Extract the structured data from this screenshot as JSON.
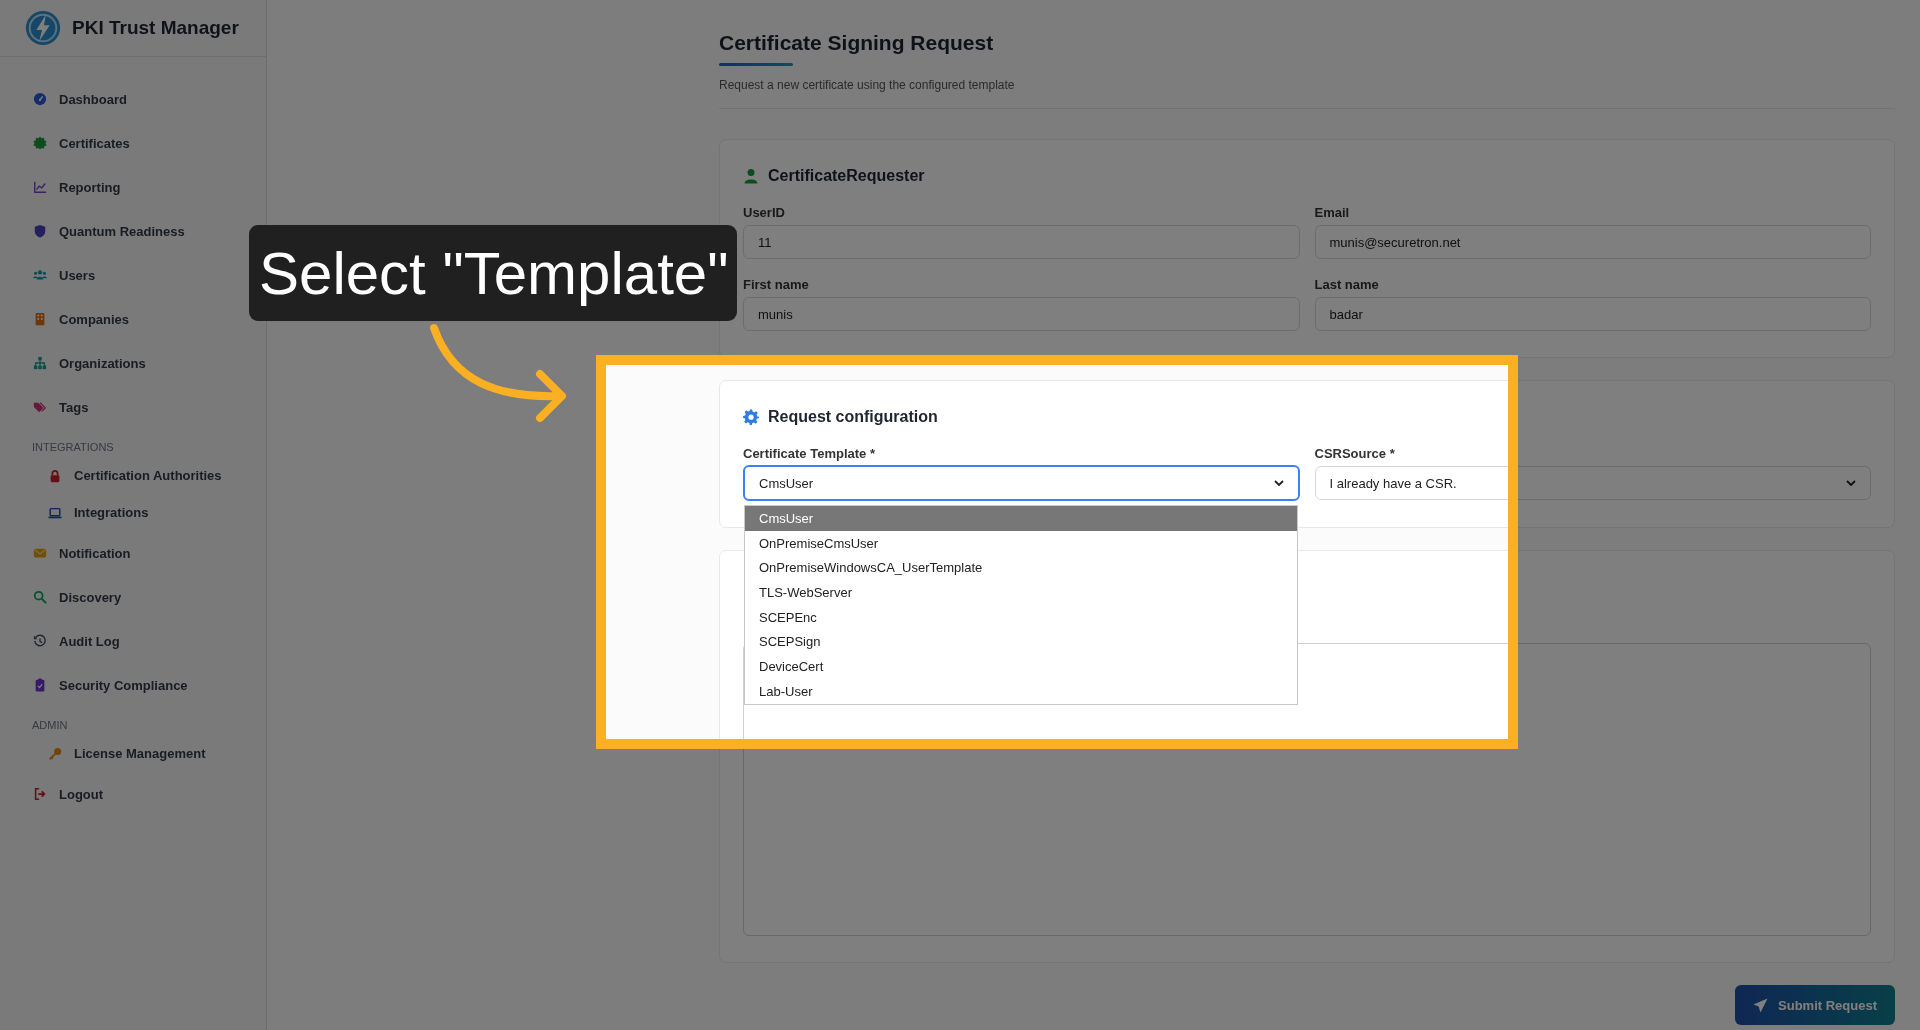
{
  "sidebar": {
    "brand": "PKI Trust Manager",
    "nav": [
      {
        "kind": "link",
        "label": "Dashboard"
      },
      {
        "kind": "link",
        "label": "Certificates"
      },
      {
        "kind": "link",
        "label": "Reporting"
      },
      {
        "kind": "link",
        "label": "Quantum Readiness"
      },
      {
        "kind": "link",
        "label": "Users"
      },
      {
        "kind": "link",
        "label": "Companies"
      },
      {
        "kind": "link",
        "label": "Organizations"
      },
      {
        "kind": "link",
        "label": "Tags"
      },
      {
        "kind": "heading",
        "label": "INTEGRATIONS",
        "children": [
          {
            "label": "Certification Authorities"
          },
          {
            "label": "Integrations"
          }
        ]
      },
      {
        "kind": "link",
        "label": "Notification"
      },
      {
        "kind": "link",
        "label": "Discovery"
      },
      {
        "kind": "link",
        "label": "Audit Log"
      },
      {
        "kind": "link",
        "label": "Security Compliance"
      },
      {
        "kind": "heading",
        "label": "ADMIN",
        "children": [
          {
            "label": "License Management"
          }
        ]
      },
      {
        "kind": "link",
        "label": "Logout"
      }
    ]
  },
  "page": {
    "title": "Certificate Signing Request",
    "subtitle": "Request a new certificate using the configured template"
  },
  "sections": [
    {
      "title": "CertificateRequester",
      "fields": [
        {
          "kind": "text",
          "label": "UserID",
          "value": "11"
        },
        {
          "kind": "text",
          "label": "Email",
          "value": "munis@securetron.net"
        },
        {
          "kind": "text",
          "label": "First name",
          "value": "munis"
        },
        {
          "kind": "text",
          "label": "Last name",
          "value": "badar"
        }
      ]
    },
    {
      "title": "Request configuration",
      "fields": [
        {
          "kind": "select",
          "label": "Certificate Template *",
          "value": "CmsUser",
          "focused": true,
          "options": [
            {
              "label": "CmsUser",
              "selected": true
            },
            {
              "label": "OnPremiseCmsUser",
              "selected": false
            },
            {
              "label": "OnPremiseWindowsCA_UserTemplate",
              "selected": false
            },
            {
              "label": "TLS-WebServer",
              "selected": false
            },
            {
              "label": "SCEPEnc",
              "selected": false
            },
            {
              "label": "SCEPSign",
              "selected": false
            },
            {
              "label": "DeviceCert",
              "selected": false
            },
            {
              "label": "Lab-User",
              "selected": false
            }
          ]
        },
        {
          "kind": "select",
          "label": "CSRSource *",
          "value": "I already have a CSR.",
          "focused": false
        }
      ]
    },
    {
      "fields": [
        {
          "kind": "textarea"
        }
      ]
    }
  ],
  "submit_button": "Submit Request",
  "tutorial": {
    "callout": "Select \"Template\""
  }
}
